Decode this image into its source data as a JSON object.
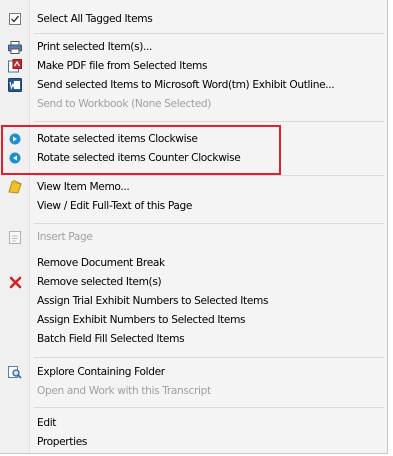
{
  "menu": {
    "items": {
      "select_all": {
        "label": "Select All Tagged Items",
        "icon": "checkbox-icon",
        "disabled": false
      },
      "print": {
        "label": "Print selected Item(s)...",
        "icon": "printer-icon",
        "disabled": false
      },
      "pdf": {
        "label": "Make PDF file from Selected Items",
        "icon": "pdf-icon",
        "disabled": false
      },
      "word": {
        "label": "Send selected Items to Microsoft Word(tm) Exhibit Outline...",
        "icon": "word-icon",
        "disabled": false
      },
      "workbook": {
        "label": "Send to Workbook (None Selected)",
        "icon": "",
        "disabled": true
      },
      "rotate_cw": {
        "label": "Rotate selected items Clockwise",
        "icon": "rotate-clockwise-icon",
        "disabled": false
      },
      "rotate_ccw": {
        "label": "Rotate selected items Counter Clockwise",
        "icon": "rotate-counterclockwise-icon",
        "disabled": false
      },
      "memo": {
        "label": "View Item Memo...",
        "icon": "memo-icon",
        "disabled": false
      },
      "fulltext": {
        "label": "View / Edit Full-Text of this Page",
        "icon": "",
        "disabled": false
      },
      "insert_page": {
        "label": "Insert Page",
        "icon": "insert-page-icon",
        "disabled": true
      },
      "remove_break": {
        "label": "Remove Document Break",
        "icon": "",
        "disabled": false
      },
      "remove_items": {
        "label": "Remove selected Item(s)",
        "icon": "remove-x-icon",
        "disabled": false
      },
      "trial_numbers": {
        "label": "Assign Trial Exhibit Numbers to Selected Items",
        "icon": "",
        "disabled": false
      },
      "exhibit_numbers": {
        "label": "Assign Exhibit Numbers to Selected Items",
        "icon": "",
        "disabled": false
      },
      "batch_fill": {
        "label": "Batch Field Fill Selected Items",
        "icon": "",
        "disabled": false
      },
      "explore": {
        "label": "Explore Containing Folder",
        "icon": "folder-search-icon",
        "disabled": false
      },
      "open_transcript": {
        "label": "Open and Work with this Transcript",
        "icon": "",
        "disabled": true
      },
      "edit": {
        "label": "Edit",
        "icon": "",
        "disabled": false
      },
      "properties": {
        "label": "Properties",
        "icon": "",
        "disabled": false
      }
    },
    "colors": {
      "highlight_border": "#e0202a",
      "disabled_text": "#a0a0a0",
      "menu_bg": "#f4f4f4"
    }
  }
}
